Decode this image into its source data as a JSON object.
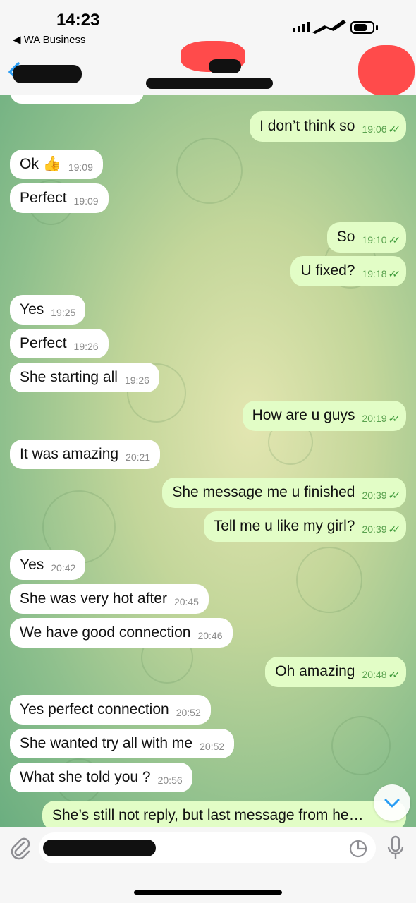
{
  "status_bar": {
    "time": "14:23",
    "back_app": "◀ WA Business"
  },
  "messages": [
    {
      "dir": "out",
      "text": "I don’t think so",
      "time": "19:06",
      "ticks": "✓✓"
    },
    {
      "dir": "in",
      "text": "Ok 👍",
      "time": "19:09"
    },
    {
      "dir": "in",
      "text": "Perfect",
      "time": "19:09"
    },
    {
      "dir": "out",
      "text": "So",
      "time": "19:10",
      "ticks": "✓✓"
    },
    {
      "dir": "out",
      "text": "U fixed?",
      "time": "19:18",
      "ticks": "✓✓"
    },
    {
      "dir": "in",
      "text": "Yes",
      "time": "19:25"
    },
    {
      "dir": "in",
      "text": "Perfect",
      "time": "19:26"
    },
    {
      "dir": "in",
      "text": "She starting all",
      "time": "19:26"
    },
    {
      "dir": "out",
      "text": "How are u guys",
      "time": "20:19",
      "ticks": "✓✓"
    },
    {
      "dir": "in",
      "text": "It was amazing",
      "time": "20:21"
    },
    {
      "dir": "out",
      "text": "She message me u finished",
      "time": "20:39",
      "ticks": "✓✓"
    },
    {
      "dir": "out",
      "text": "Tell me u like my girl?",
      "time": "20:39",
      "ticks": "✓✓"
    },
    {
      "dir": "in",
      "text": "Yes",
      "time": "20:42"
    },
    {
      "dir": "in",
      "text": "She was very hot after",
      "time": "20:45"
    },
    {
      "dir": "in",
      "text": "We have good connection",
      "time": "20:46"
    },
    {
      "dir": "out",
      "text": "Oh amazing",
      "time": "20:48",
      "ticks": "✓✓"
    },
    {
      "dir": "in",
      "text": "Yes perfect connection",
      "time": "20:52"
    },
    {
      "dir": "in",
      "text": "She wanted try all with me",
      "time": "20:52"
    },
    {
      "dir": "in",
      "text": "What she told you ?",
      "time": "20:56"
    },
    {
      "dir": "out",
      "text": "She’s still not reply, but last message from he…",
      "time": "",
      "ticks": ""
    }
  ],
  "icons": {
    "back": "chevron-left-icon",
    "attach": "paperclip-icon",
    "sticker": "sticker-icon",
    "mic": "microphone-icon",
    "scroll_down": "chevron-down-icon"
  },
  "colors": {
    "incoming": "#ffffff",
    "outgoing": "#e2fdc6",
    "accent": "#2a9df4",
    "timestamp_out": "#5aa24f"
  }
}
